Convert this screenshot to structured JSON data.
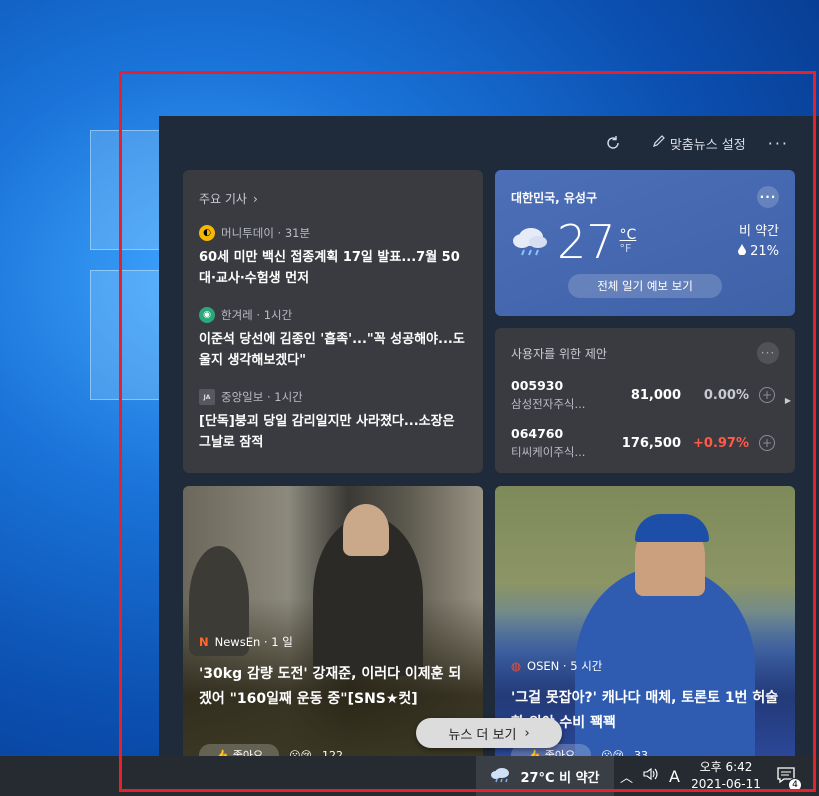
{
  "panel": {
    "personalize_label": "맞춤뉴스 설정",
    "more_label": "···"
  },
  "top_stories": {
    "heading": "주요 기사",
    "articles": [
      {
        "source": "머니투데이 · 31분",
        "headline": "60세 미만 백신 접종계획 17일 발표...7월 50대·교사·수험생 먼저"
      },
      {
        "source": "한겨레 · 1시간",
        "headline": "이준석 당선에 김종인 '흡족'...\"꼭 성공해야...도울지 생각해보겠다\""
      },
      {
        "source": "중앙일보 · 1시간",
        "headline": "[단독]붕괴 당일 감리일지만 사라졌다...소장은 그날로 잠적"
      }
    ]
  },
  "weather": {
    "location": "대한민국, 유성구",
    "temp": "27",
    "unit_c": "°C",
    "unit_f": "°F",
    "condition": "비 약간",
    "precip": "21%",
    "forecast_button": "전체 일기 예보 보기",
    "colors": {
      "card": "#4c6fb8"
    }
  },
  "stocks": {
    "heading": "사용자를 위한 제안",
    "items": [
      {
        "code": "005930",
        "name": "삼성전자주식...",
        "price": "81,000",
        "change": "0.00%",
        "change_color": "#c8ccd2"
      },
      {
        "code": "064760",
        "name": "티씨케이주식...",
        "price": "176,500",
        "change": "+0.97%",
        "change_color": "#ff5a4a"
      }
    ]
  },
  "photo_news": [
    {
      "source": "NewsEn · 1 일",
      "title": "'30kg 감량 도전' 강재준, 이러다 이제훈 되겠어 \"160일째 운동 중\"[SNS★컷]",
      "like_label": "좋아요",
      "reaction_count": "122"
    },
    {
      "source": "OSEN · 5 시간",
      "title": "'그걸 못잡아?' 캐나다 매체, 토론토 1번 허술한 외야 수비 꽥꽥",
      "like_label": "좋아요",
      "reaction_count": "33"
    }
  ],
  "more_news_button": "뉴스 더 보기",
  "taskbar": {
    "weather": "27°C  비 약간",
    "ime": "A",
    "time": "오후 6:42",
    "date": "2021-06-11",
    "notification_count": "4"
  }
}
